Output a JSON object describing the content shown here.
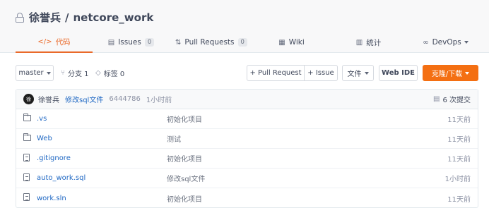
{
  "repo": {
    "owner": "徐誉兵",
    "separator": "/",
    "name": "netcore_work"
  },
  "tabs": [
    {
      "icon": "</>",
      "label": "代码",
      "badge": ""
    },
    {
      "icon": "▤",
      "label": "Issues",
      "badge": "0"
    },
    {
      "icon": "⇅",
      "label": "Pull Requests",
      "badge": "0"
    },
    {
      "icon": "▦",
      "label": "Wiki",
      "badge": ""
    },
    {
      "icon": "▥",
      "label": "统计",
      "badge": ""
    },
    {
      "icon": "∞",
      "label": "DevOps",
      "badge": ""
    }
  ],
  "toolbar": {
    "branch": "master",
    "branches_label": "分支 1",
    "tags_label": "标签 0",
    "pull_request_label": "+ Pull Request",
    "issue_label": "+ Issue",
    "file_label": "文件",
    "webide_label": "Web IDE",
    "clone_label": "克隆/下载"
  },
  "commit": {
    "avatar_text": "徐",
    "author": "徐誉兵",
    "message": "修改sql文件",
    "hash": "6444786",
    "time": "1小时前",
    "count_label": "6 次提交"
  },
  "files": [
    {
      "type": "folder",
      "name": ".vs",
      "message": "初始化项目",
      "time": "11天前"
    },
    {
      "type": "folder",
      "name": "Web",
      "message": "测试",
      "time": "11天前"
    },
    {
      "type": "file",
      "name": ".gitignore",
      "message": "初始化项目",
      "time": "11天前"
    },
    {
      "type": "file",
      "name": "auto_work.sql",
      "message": "修改sql文件",
      "time": "1小时前"
    },
    {
      "type": "file",
      "name": "work.sln",
      "message": "初始化项目",
      "time": "11天前"
    }
  ],
  "colors": {
    "accent": "#ea6a2a",
    "clone_button": "#f46f12",
    "link": "#1e67c3"
  }
}
